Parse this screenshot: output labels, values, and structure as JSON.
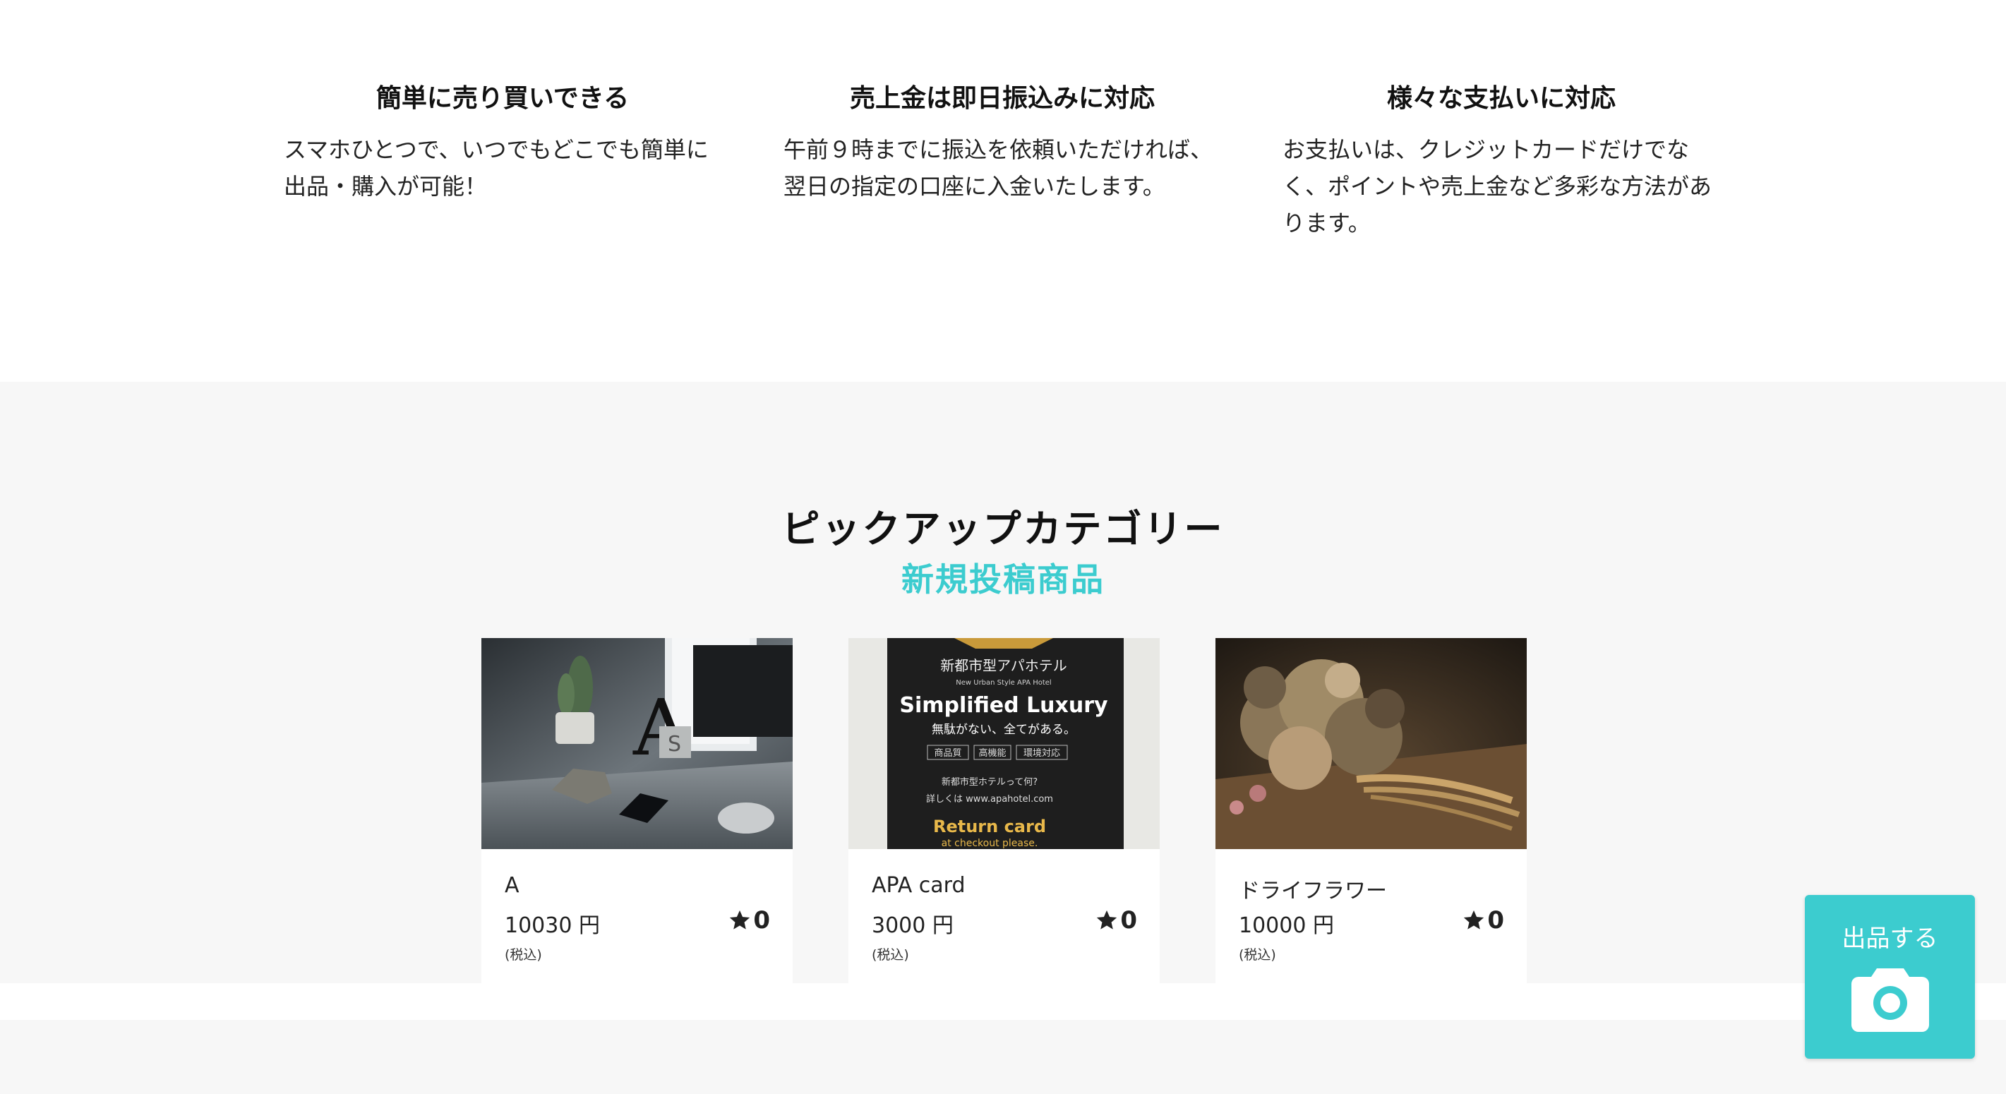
{
  "features": [
    {
      "title": "簡単に売り買いできる",
      "body": "スマホひとつで、いつでもどこでも簡単に出品・購入が可能！"
    },
    {
      "title": "売上金は即日振込みに対応",
      "body": "午前９時までに振込を依頼いただければ、翌日の指定の口座に入金いたします。"
    },
    {
      "title": "様々な支払いに対応",
      "body": "お支払いは、クレジットカードだけでなく、ポイントや売上金など多彩な方法があります。"
    }
  ],
  "pickup": {
    "title": "ピックアップカテゴリー",
    "subtitle": "新規投稿商品",
    "items": [
      {
        "name": "A",
        "price": "10030 円",
        "tax": "(税込)",
        "likes": "0"
      },
      {
        "name": "APA card",
        "price": "3000 円",
        "tax": "(税込)",
        "likes": "0"
      },
      {
        "name": "ドライフラワー",
        "price": "10000 円",
        "tax": "(税込)",
        "likes": "0"
      }
    ],
    "apa_image_text": {
      "l1": "新都市型アパホテル",
      "l2": "New Urban Style APA Hotel",
      "l3": "Simplified Luxury",
      "l4": "無駄がない、全てがある。",
      "l5": "商品質",
      "l6": "高機能",
      "l7": "環境対応",
      "l8": "新都市型ホテルって何?",
      "l9": "詳しくは www.apahotel.com",
      "l10": "Return card",
      "l11": "at checkout please."
    },
    "desk_image_letters": {
      "big": "A",
      "cube": "S"
    }
  },
  "sell_button": {
    "label": "出品する",
    "icon": "camera-icon"
  },
  "colors": {
    "accent": "#3ccccf",
    "section_bg": "#f7f7f7"
  }
}
